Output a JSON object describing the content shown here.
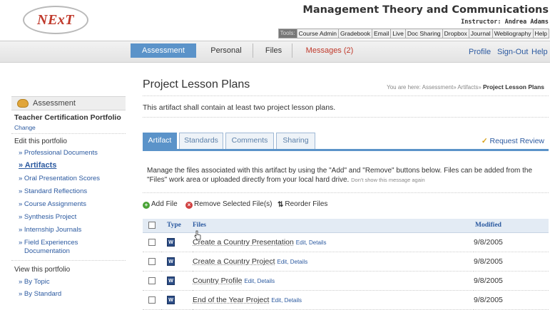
{
  "header": {
    "logo_text": "NExT",
    "course_title": "Management Theory and Communications",
    "instructor": "Instructor: Andrea Adams",
    "toolbar": [
      {
        "label": "Tools:"
      },
      {
        "label": "Course Admin"
      },
      {
        "label": "Gradebook"
      },
      {
        "label": "Email"
      },
      {
        "label": "Live"
      },
      {
        "label": "Doc Sharing"
      },
      {
        "label": "Dropbox"
      },
      {
        "label": "Journal"
      },
      {
        "label": "Webliography"
      },
      {
        "label": "Help"
      }
    ]
  },
  "topnav": {
    "tabs": [
      {
        "label": "Assessment"
      },
      {
        "label": "Personal"
      },
      {
        "label": "Files"
      },
      {
        "label": "Messages (2)"
      }
    ],
    "utility": [
      {
        "label": "Profile"
      },
      {
        "label": "Sign-Out"
      },
      {
        "label": "Help"
      }
    ]
  },
  "sidebar": {
    "header": "Assessment",
    "portfolio_title": "Teacher Certification Portfolio",
    "change_label": "Change",
    "edit_heading": "Edit this portfolio",
    "edit_items": [
      {
        "label": "» Professional Documents"
      },
      {
        "label": "» Artifacts"
      },
      {
        "label": "» Oral Presentation Scores"
      },
      {
        "label": "» Standard Reflections"
      },
      {
        "label": "» Course Assignments"
      },
      {
        "label": "» Synthesis Project"
      },
      {
        "label": "» Internship Journals"
      },
      {
        "label": "» Field Experiences"
      },
      {
        "label": "Documentation"
      }
    ],
    "view_heading": "View this portfolio",
    "view_items": [
      {
        "label": "» By Topic"
      },
      {
        "label": "» By Standard"
      }
    ]
  },
  "main": {
    "title": "Project Lesson Plans",
    "breadcrumb_prefix": "You are here:",
    "breadcrumb_path": "Assessment» Artifacts»",
    "breadcrumb_current": "Project Lesson Plans",
    "description": "This artifact shall contain at least two project lesson plans.",
    "subtabs": [
      {
        "label": "Artifact"
      },
      {
        "label": "Standards"
      },
      {
        "label": "Comments"
      },
      {
        "label": "Sharing"
      }
    ],
    "request_review": "Request Review",
    "manage_text": "Manage the files associated with this artifact by using the \"Add\" and \"Remove\" buttons below. Files can be added from the \"Files\" work area or uploaded directly from your local hard drive.",
    "dont_show": "Don't show this message again",
    "actions": {
      "add": "Add File",
      "remove": "Remove Selected File(s)",
      "reorder": "Reorder Files"
    },
    "table": {
      "columns": {
        "type": "Type",
        "files": "Files",
        "modified": "Modified"
      },
      "rows": [
        {
          "name": "Create a Country Presentation",
          "edit": "Edit",
          "details": "Details",
          "modified": "9/8/2005"
        },
        {
          "name": "Create a Country Project",
          "edit": "Edit",
          "details": "Details",
          "modified": "9/8/2005"
        },
        {
          "name": "Country Profile",
          "edit": "Edit",
          "details": "Details",
          "modified": "9/8/2005"
        },
        {
          "name": "End of the Year Project",
          "edit": "Edit",
          "details": "Details",
          "modified": "9/8/2005"
        }
      ]
    }
  },
  "colors": {
    "accent_blue": "#5b93c9",
    "link_blue": "#2c5aa0",
    "messages_red": "#c0392b",
    "logo_red": "#c0392b"
  }
}
